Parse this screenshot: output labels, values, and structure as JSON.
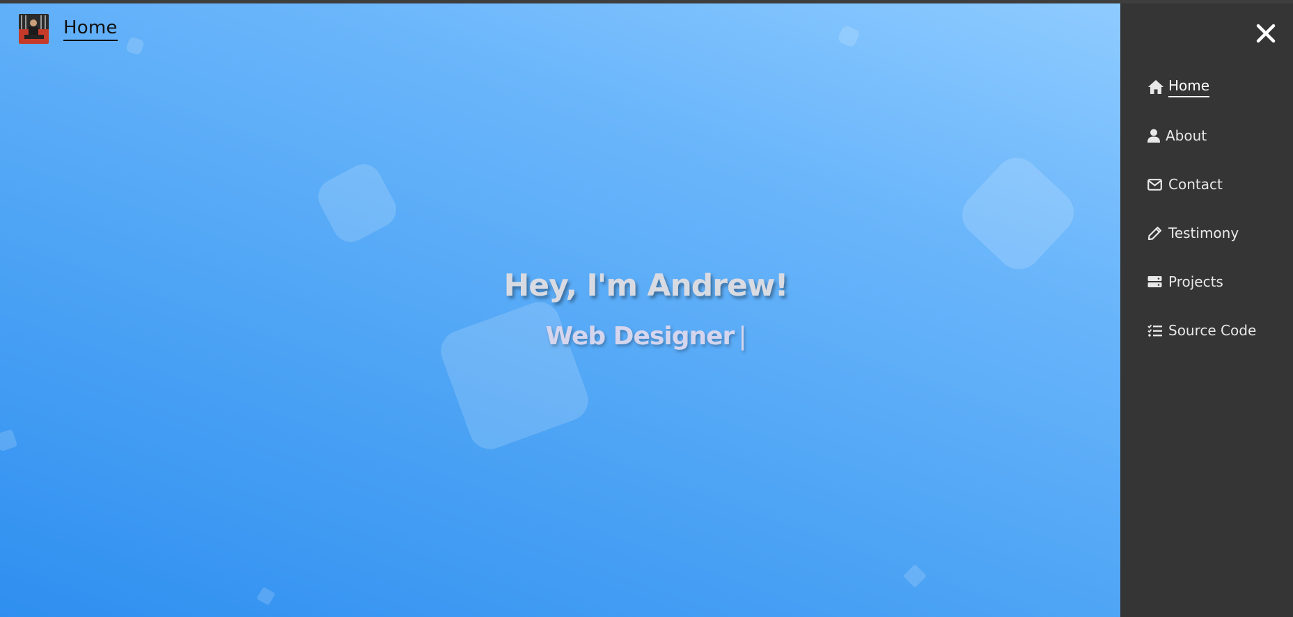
{
  "header": {
    "title": "Home",
    "avatar_icon": "profile-photo"
  },
  "hero": {
    "headline": "Hey, I'm Andrew!",
    "subline": "Web Designer",
    "cursor": "|"
  },
  "sidebar": {
    "close_icon": "close-icon",
    "items": [
      {
        "label": "Home",
        "icon": "home-icon",
        "active": true
      },
      {
        "label": "About",
        "icon": "user-icon",
        "active": false
      },
      {
        "label": "Contact",
        "icon": "envelope-icon",
        "active": false
      },
      {
        "label": "Testimony",
        "icon": "pencil-icon",
        "active": false
      },
      {
        "label": "Projects",
        "icon": "server-icon",
        "active": false
      },
      {
        "label": "Source Code",
        "icon": "checklist-icon",
        "active": false
      }
    ]
  },
  "colors": {
    "sidebar_bg": "#353535",
    "hero_gradient_light": "#8ecbff",
    "hero_gradient_dark": "#2f8ff0",
    "headline_text": "#d9dbe2"
  }
}
